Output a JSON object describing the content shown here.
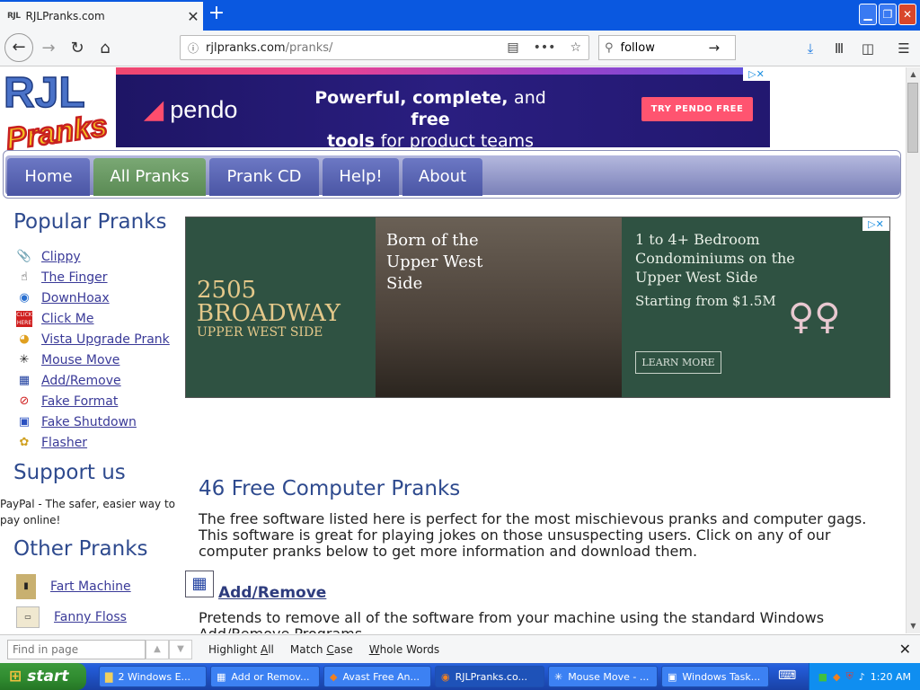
{
  "browser": {
    "tab_favicon": "RJL",
    "tab_title": "RJLPranks.com",
    "url_domain": "rjlpranks.com",
    "url_path": "/pranks/",
    "search_value": "follow"
  },
  "site": {
    "logo_top": "RJL",
    "logo_bottom": "Pranks",
    "menu": [
      "Home",
      "All Pranks",
      "Prank CD",
      "Help!",
      "About"
    ],
    "active_menu": "All Pranks",
    "popular_title": "Popular Pranks",
    "popular": [
      {
        "label": "Clippy",
        "icon": "paperclip-icon"
      },
      {
        "label": "The Finger",
        "icon": "hand-icon"
      },
      {
        "label": "DownHoax",
        "icon": "globe-icon"
      },
      {
        "label": "Click Me",
        "icon": "click-me-icon"
      },
      {
        "label": "Vista Upgrade Prank",
        "icon": "vista-icon"
      },
      {
        "label": "Mouse Move",
        "icon": "mouse-move-icon"
      },
      {
        "label": "Add/Remove",
        "icon": "add-remove-icon"
      },
      {
        "label": "Fake Format",
        "icon": "no-format-icon"
      },
      {
        "label": "Fake Shutdown",
        "icon": "computer-icon"
      },
      {
        "label": "Flasher",
        "icon": "flasher-icon"
      }
    ],
    "support_title": "Support us",
    "paypal_text": "PayPal - The safer, easier way to pay online!",
    "other_title": "Other Pranks",
    "other": [
      {
        "label": "Fart Machine",
        "icon": "fart-machine-icon"
      },
      {
        "label": "Fanny Floss",
        "icon": "fanny-floss-icon"
      }
    ],
    "main_title": "46 Free Computer Pranks",
    "main_text": "The free software listed here is perfect for the most mischievous pranks and computer gags. This software is great for playing jokes on those unsuspecting users. Click on any of our computer pranks below to get more information and download them.",
    "first_prank_title": "Add/Remove",
    "first_prank_desc": "Pretends to remove all of the software from your machine using the standard Windows Add/Remove Programs"
  },
  "ad1": {
    "brand": "pendo",
    "headline_a": "Powerful, complete,",
    "headline_and": "and",
    "headline_free": "free",
    "headline_b": "tools",
    "headline_c": "for product teams",
    "cta": "TRY PENDO FREE"
  },
  "ad2": {
    "big": "2505 BROADWAY",
    "small": "UPPER WEST SIDE",
    "photo_caption": "Born of the Upper West Side",
    "right_text": "1 to 4+ Bedroom Condominiums on the Upper West Side",
    "price": "Starting from $1.5M",
    "cta": "LEARN MORE"
  },
  "findbar": {
    "placeholder": "Find in page",
    "highlight_pre": "Highlight ",
    "highlight_u": "A",
    "highlight_post": "ll",
    "match_pre": "Match ",
    "match_u": "C",
    "match_post": "ase",
    "whole_u": "W",
    "whole_post": "hole Words"
  },
  "taskbar": {
    "start": "start",
    "tasks": [
      "2 Windows E...",
      "Add or Remov...",
      "Avast Free An...",
      "RJLPranks.co...",
      "Mouse Move - ...",
      "Windows Task..."
    ],
    "active_task": "RJLPranks.co...",
    "time": "1:20 AM"
  }
}
